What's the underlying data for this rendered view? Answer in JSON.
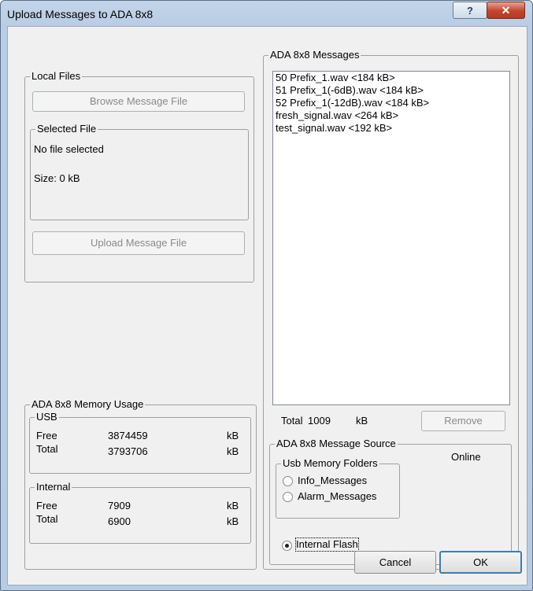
{
  "window": {
    "title": "Upload Messages to ADA 8x8"
  },
  "titlebar": {
    "help_glyph": "?",
    "close_glyph": "✕"
  },
  "local_files": {
    "title": "Local Files",
    "browse_label": "Browse Message File",
    "selected_file": {
      "title": "Selected File",
      "name_text": "No file selected",
      "size_text": "Size:  0  kB"
    },
    "upload_label": "Upload Message File"
  },
  "memory_usage": {
    "title": "ADA 8x8 Memory Usage",
    "usb": {
      "title": "USB",
      "free_label": "Free",
      "free_value": "3874459",
      "total_label": "Total",
      "total_value": "3793706",
      "unit": "kB"
    },
    "internal": {
      "title": "Internal",
      "free_label": "Free",
      "free_value": "7909",
      "total_label": "Total",
      "total_value": "6900",
      "unit": "kB"
    }
  },
  "messages": {
    "title": "ADA 8x8 Messages",
    "items": [
      "50 Prefix_1.wav <184 kB>",
      "51 Prefix_1(-6dB).wav <184 kB>",
      "52 Prefix_1(-12dB).wav <184 kB>",
      "fresh_signal.wav <264 kB>",
      "test_signal.wav <192 kB>"
    ],
    "total_label": "Total",
    "total_value": "1009",
    "total_unit": "kB",
    "remove_label": "Remove"
  },
  "source": {
    "title": "ADA 8x8 Message Source",
    "status": "Online",
    "usb_folders": {
      "title": "Usb Memory Folders",
      "options": [
        "Info_Messages",
        "Alarm_Messages"
      ]
    },
    "internal_label": "Internal Flash",
    "selected": "Internal Flash"
  },
  "footer": {
    "cancel_label": "Cancel",
    "ok_label": "OK"
  }
}
